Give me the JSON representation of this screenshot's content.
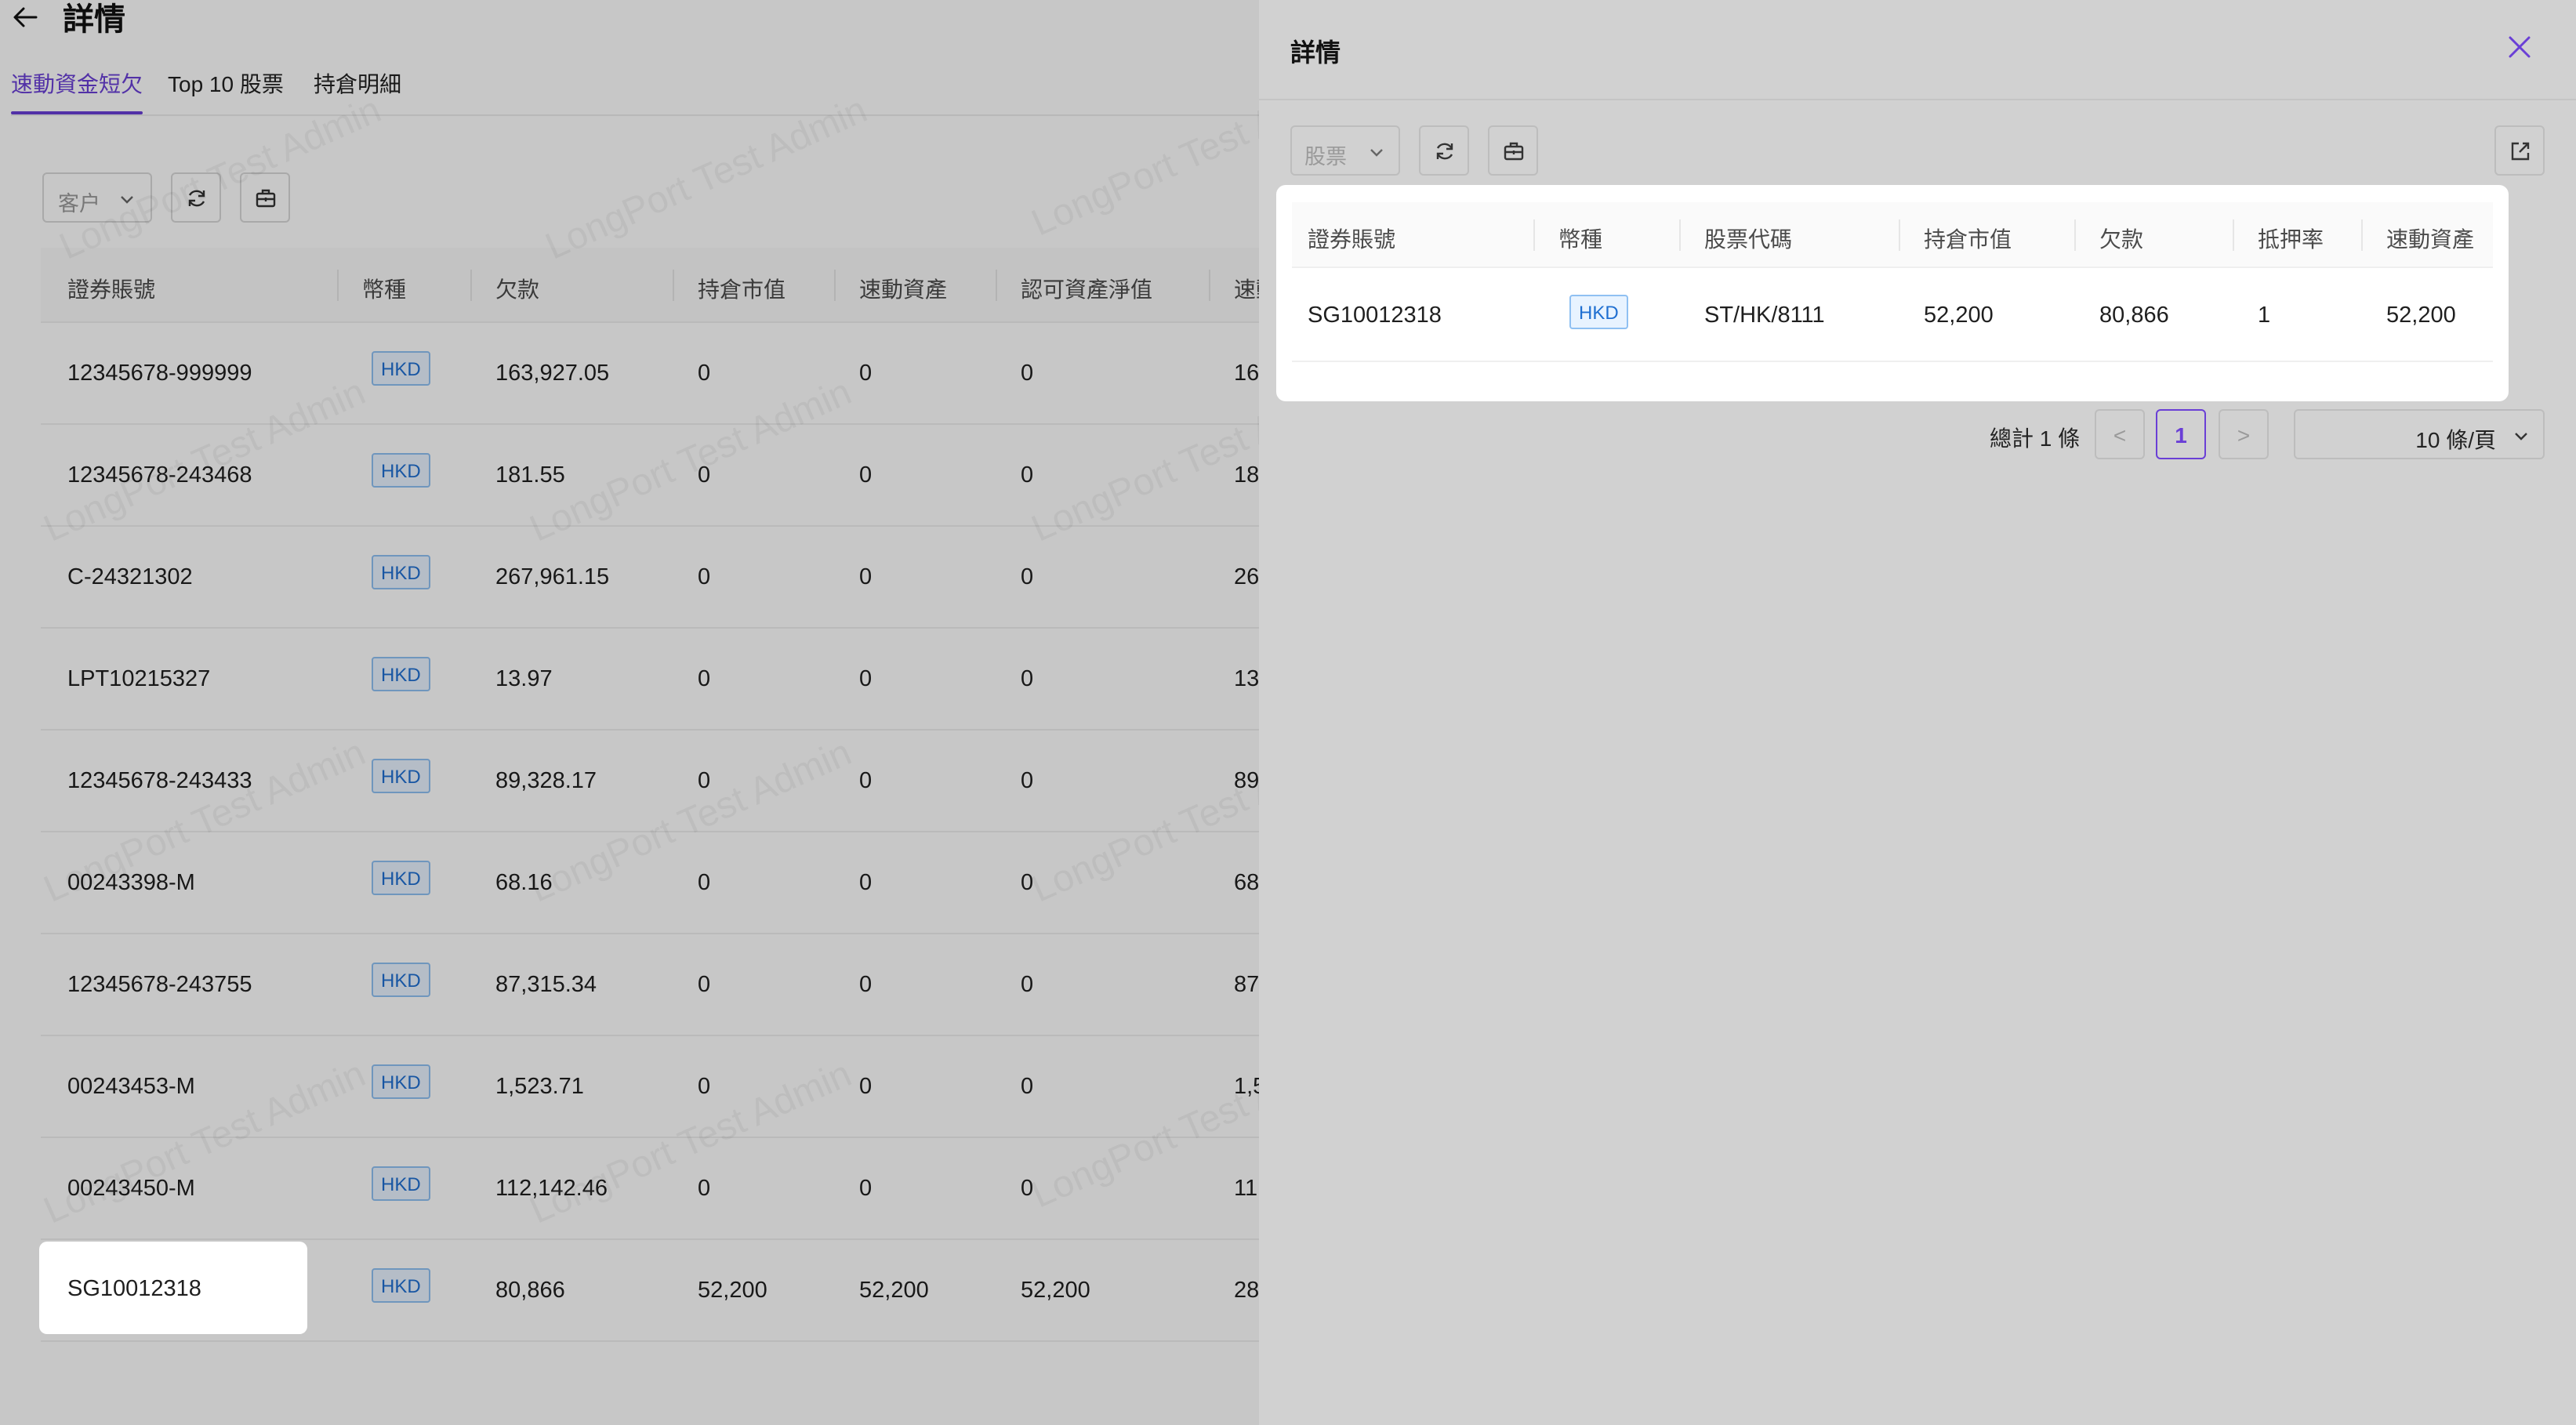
{
  "page": {
    "title": "詳情",
    "tabs": [
      {
        "label": "速動資金短欠",
        "active": true
      },
      {
        "label": "Top 10 股票",
        "active": false
      },
      {
        "label": "持倉明細",
        "active": false
      }
    ]
  },
  "watermark_text": "LongPort Test Admin",
  "filters": {
    "select_placeholder": "客户"
  },
  "table": {
    "columns": [
      "證券賬號",
      "幣種",
      "欠款",
      "持倉市值",
      "速動資產",
      "認可資產淨值",
      "速動"
    ],
    "rows": [
      {
        "account": "12345678-999999",
        "currency": "HKD",
        "debt": "163,927.05",
        "market_value": "0",
        "quick_assets": "0",
        "nav": "0",
        "partial": "16"
      },
      {
        "account": "12345678-243468",
        "currency": "HKD",
        "debt": "181.55",
        "market_value": "0",
        "quick_assets": "0",
        "nav": "0",
        "partial": "18"
      },
      {
        "account": "C-24321302",
        "currency": "HKD",
        "debt": "267,961.15",
        "market_value": "0",
        "quick_assets": "0",
        "nav": "0",
        "partial": "26"
      },
      {
        "account": "LPT10215327",
        "currency": "HKD",
        "debt": "13.97",
        "market_value": "0",
        "quick_assets": "0",
        "nav": "0",
        "partial": "13"
      },
      {
        "account": "12345678-243433",
        "currency": "HKD",
        "debt": "89,328.17",
        "market_value": "0",
        "quick_assets": "0",
        "nav": "0",
        "partial": "89"
      },
      {
        "account": "00243398-M",
        "currency": "HKD",
        "debt": "68.16",
        "market_value": "0",
        "quick_assets": "0",
        "nav": "0",
        "partial": "68"
      },
      {
        "account": "12345678-243755",
        "currency": "HKD",
        "debt": "87,315.34",
        "market_value": "0",
        "quick_assets": "0",
        "nav": "0",
        "partial": "87"
      },
      {
        "account": "00243453-M",
        "currency": "HKD",
        "debt": "1,523.71",
        "market_value": "0",
        "quick_assets": "0",
        "nav": "0",
        "partial": "1,5"
      },
      {
        "account": "00243450-M",
        "currency": "HKD",
        "debt": "112,142.46",
        "market_value": "0",
        "quick_assets": "0",
        "nav": "0",
        "partial": "11"
      },
      {
        "account": "SG10012318",
        "currency": "HKD",
        "debt": "80,866",
        "market_value": "52,200",
        "quick_assets": "52,200",
        "nav": "52,200",
        "partial": "28"
      }
    ]
  },
  "drawer": {
    "title": "詳情",
    "select_placeholder": "股票",
    "columns": [
      "證券賬號",
      "幣種",
      "股票代碼",
      "持倉市值",
      "欠款",
      "抵押率",
      "速動資產"
    ],
    "rows": [
      {
        "account": "SG10012318",
        "currency": "HKD",
        "stock_code": "ST/HK/8111",
        "market_value": "52,200",
        "debt": "80,866",
        "ratio": "1",
        "quick_assets": "52,200"
      }
    ],
    "pagination": {
      "total_text": "總計 1 條",
      "prev": "<",
      "current_page": "1",
      "next": ">",
      "page_size": "10 條/頁"
    }
  },
  "colors": {
    "accent": "#6a3fd6",
    "tag_text": "#1f6fd1",
    "tag_bg": "#e8f3ff"
  }
}
